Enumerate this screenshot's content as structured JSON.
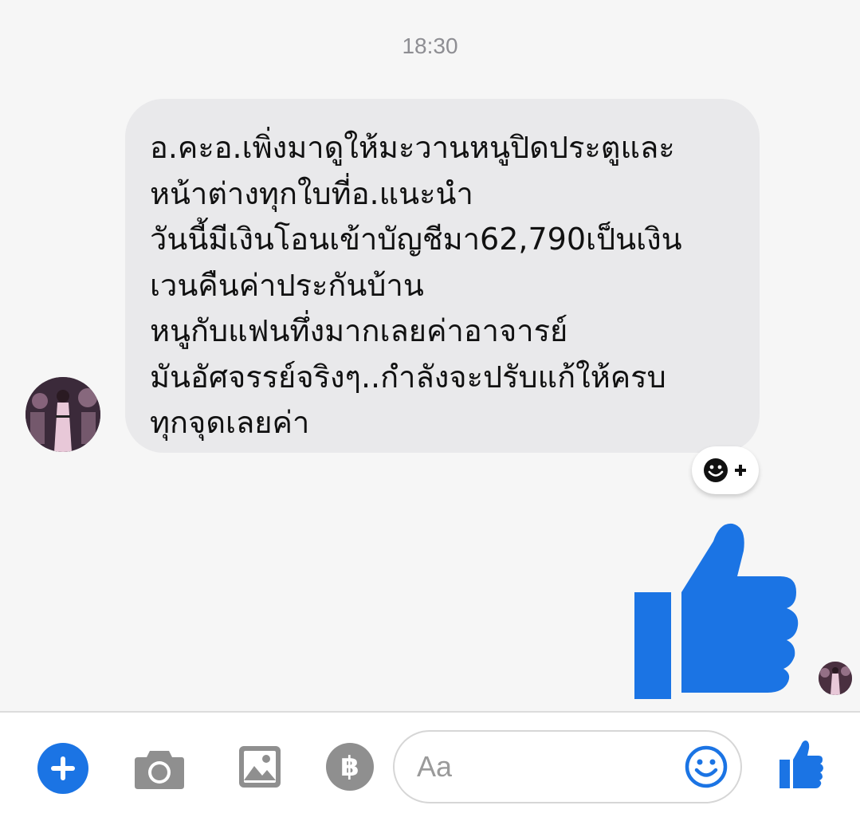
{
  "chat": {
    "timestamp": "18:30",
    "message_lines": [
      "อ.คะอ.เพิ่งมาดูให้มะวานหนูปิดประตูและ",
      "หน้าต่างทุกใบที่อ.แนะนำ",
      "วันนี้มีเงินโอนเข้าบัญชีมา62,790เป็นเงิน",
      "เวนคืนค่าประกันบ้าน",
      "หนูกับแฟนทึ่งมากเลยค่าอาจารย์",
      "มันอัศจรรย์จริงๆ..กำลังจะปรับแก้ให้ครบ",
      "ทุกจุดเลยค่า"
    ],
    "sent_message_icon": "thumbs-up-icon"
  },
  "composer": {
    "placeholder": "Aa",
    "baht_symbol": "฿",
    "icons": [
      "plus-icon",
      "camera-icon",
      "gallery-icon",
      "baht-icon",
      "emoji-icon",
      "thumbs-up-icon"
    ]
  },
  "colors": {
    "accent": "#1b74e4",
    "bubble": "#e9e9eb",
    "background": "#f6f6f6"
  }
}
